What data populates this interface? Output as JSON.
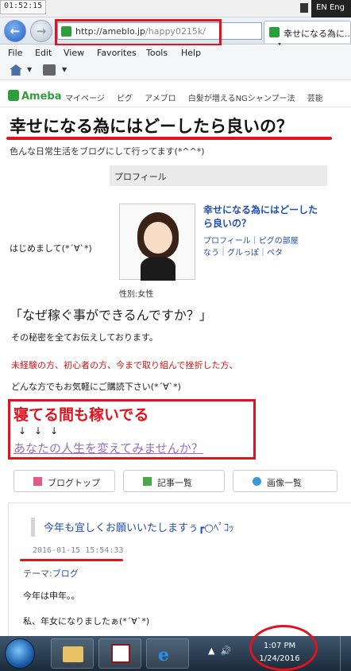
{
  "top_strip": {
    "time": "01:52:15",
    "lang": "EN Eng"
  },
  "browser": {
    "address": {
      "domain": "http://ameblo.jp",
      "path": "/happy0215k/"
    },
    "tab_title": "幸せになる為に...",
    "menu": [
      "File",
      "Edit",
      "View",
      "Favorites",
      "Tools",
      "Help"
    ]
  },
  "ameba_header": {
    "logo": "Ameba",
    "links": [
      "マイページ",
      "ピグ",
      "アメブロ",
      "白髪が増えるNGシャンプー法",
      "芸能"
    ]
  },
  "blog": {
    "title": "幸せになる為にはどーしたら良いの？",
    "description": "色んな日常生活をブログにして行ってます(*^^*)"
  },
  "profile": {
    "heading": "プロフィール",
    "name": "幸せになる為にはどーしたら良いの？",
    "links_line1": "プロフィール｜ピグの部屋",
    "links_line2": "なう｜グルっぽ｜ペタ",
    "gender": "性別:女性"
  },
  "content": {
    "hello": "はじめまして(*´∀`*)",
    "question": "「なぜ稼ぐ事ができるんですか？」",
    "secret": "その秘密を全てお伝えしております。",
    "red_line": "未経験の方、初心者の方、今まで取り組んで挫折した方、",
    "feel_free": "どんな方でもお気軽にご購読下さい(*´∀`*)",
    "promo_big": "寝てる間も稼いでる",
    "promo_arrows": "↓↓↓",
    "promo_link": "あなたの人生を変えてみませんか？"
  },
  "nav_buttons": [
    {
      "label": "ブログトップ",
      "color": "#e05a8a"
    },
    {
      "label": "記事一覧",
      "color": "#4aa84a"
    },
    {
      "label": "画像一覧",
      "color": "#3a9ad9"
    }
  ],
  "article": {
    "title": "今年も宜しくお願いいたしますぅ┏○ﾍﾟｺｯ",
    "date": "2016-01-15 15:54:33",
    "theme_label": "テーマ:",
    "theme_value": "ブログ",
    "line1": "今年は申年。。",
    "line2": "私、年女になりましたぁ(*´∀`*)"
  },
  "taskbar": {
    "time": "1:07 PM",
    "date": "1/24/2016"
  },
  "colors": {
    "highlight_red": "#e0141e",
    "link_blue": "#1f4fb5",
    "ameba_green": "#2c9f3a"
  }
}
